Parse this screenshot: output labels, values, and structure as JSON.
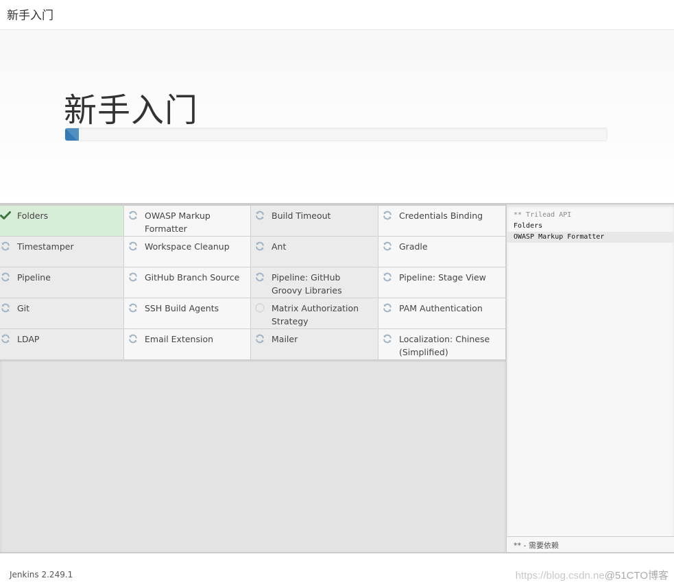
{
  "header": {
    "title": "新手入门"
  },
  "jumbotron": {
    "title": "新手入门",
    "progress_percent": 2.5
  },
  "colors": {
    "progress": "#337ab7",
    "success_bg": "#d8edd8",
    "success_icon": "#3c763d",
    "spinner_icon": "#9fb4c7"
  },
  "plugins": [
    {
      "name": "Folders",
      "status": "success"
    },
    {
      "name": "OWASP Markup Formatter",
      "status": "installing"
    },
    {
      "name": "Build Timeout",
      "status": "installing"
    },
    {
      "name": "Credentials Binding",
      "status": "installing"
    },
    {
      "name": "Timestamper",
      "status": "installing"
    },
    {
      "name": "Workspace Cleanup",
      "status": "installing"
    },
    {
      "name": "Ant",
      "status": "installing"
    },
    {
      "name": "Gradle",
      "status": "installing"
    },
    {
      "name": "Pipeline",
      "status": "installing"
    },
    {
      "name": "GitHub Branch Source",
      "status": "installing"
    },
    {
      "name": "Pipeline: GitHub Groovy Libraries",
      "status": "installing"
    },
    {
      "name": "Pipeline: Stage View",
      "status": "installing"
    },
    {
      "name": "Git",
      "status": "installing"
    },
    {
      "name": "SSH Build Agents",
      "status": "installing"
    },
    {
      "name": "Matrix Authorization Strategy",
      "status": "pending"
    },
    {
      "name": "PAM Authentication",
      "status": "installing"
    },
    {
      "name": "LDAP",
      "status": "installing"
    },
    {
      "name": "Email Extension",
      "status": "installing"
    },
    {
      "name": "Mailer",
      "status": "installing"
    },
    {
      "name": "Localization: Chinese (Simplified)",
      "status": "installing"
    }
  ],
  "log": {
    "lines": [
      {
        "text": "** Trilead API",
        "type": "dep"
      },
      {
        "text": "Folders",
        "type": "normal"
      },
      {
        "text": "OWASP Markup Formatter",
        "type": "current"
      }
    ],
    "footer": "** - 需要依赖"
  },
  "footer": {
    "version": "Jenkins 2.249.1",
    "watermark_light": "https://blog.csdn.ne",
    "watermark_strong": "@51CTO博客"
  }
}
